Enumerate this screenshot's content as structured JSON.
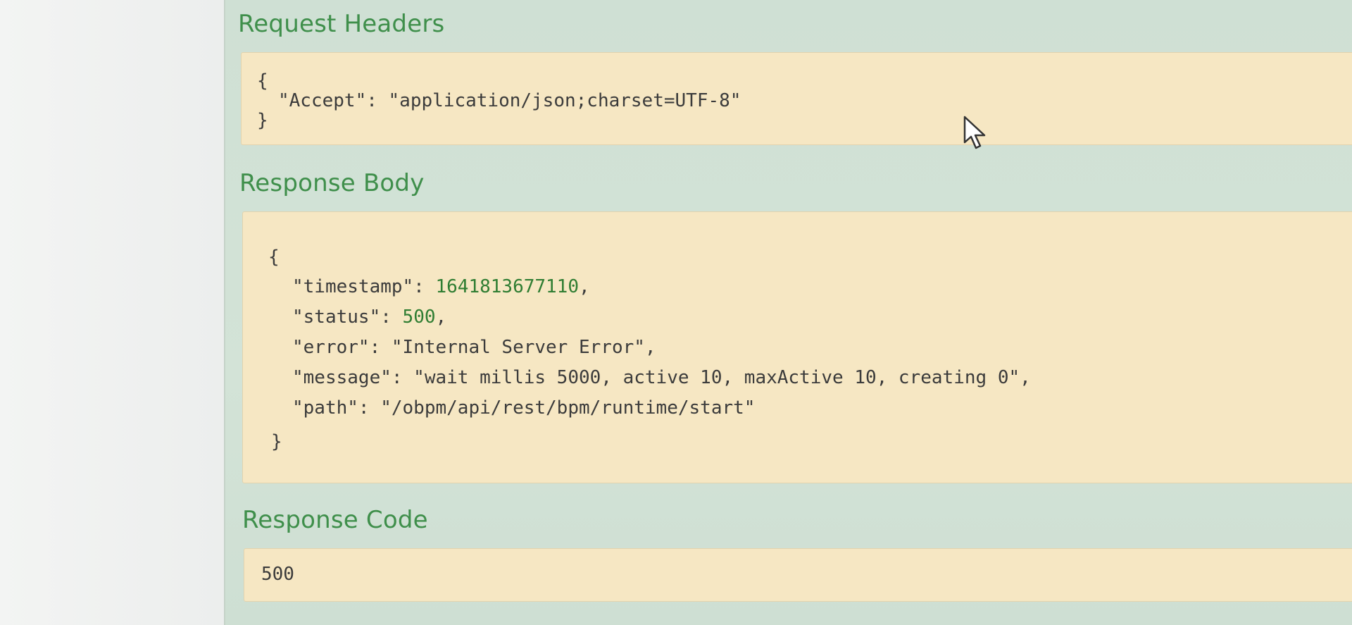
{
  "request_headers": {
    "title": "Request Headers",
    "brace_open": "{",
    "line": "\"Accept\": \"application/json;charset=UTF-8\"",
    "brace_close": "}"
  },
  "response_body": {
    "title": "Response Body",
    "brace_open": "{",
    "timestamp_key": "\"timestamp\": ",
    "timestamp_value": "1641813677110",
    "timestamp_comma": ",",
    "status_key": "\"status\": ",
    "status_value": "500",
    "status_comma": ",",
    "error_line": "\"error\": \"Internal Server Error\",",
    "message_line": "\"message\": \"wait millis 5000, active 10, maxActive 10, creating 0\",",
    "path_line": "\"path\": \"/obpm/api/rest/bpm/runtime/start\"",
    "brace_close": "}"
  },
  "response_code": {
    "title": "Response Code",
    "value": "500"
  },
  "icons": {
    "cursor": "mouse-pointer-icon"
  },
  "colors": {
    "title_green": "#3f8f4b",
    "code_background": "#f6e7c3",
    "panel_background": "#d3e3d7",
    "number_green": "#2f7d32"
  }
}
